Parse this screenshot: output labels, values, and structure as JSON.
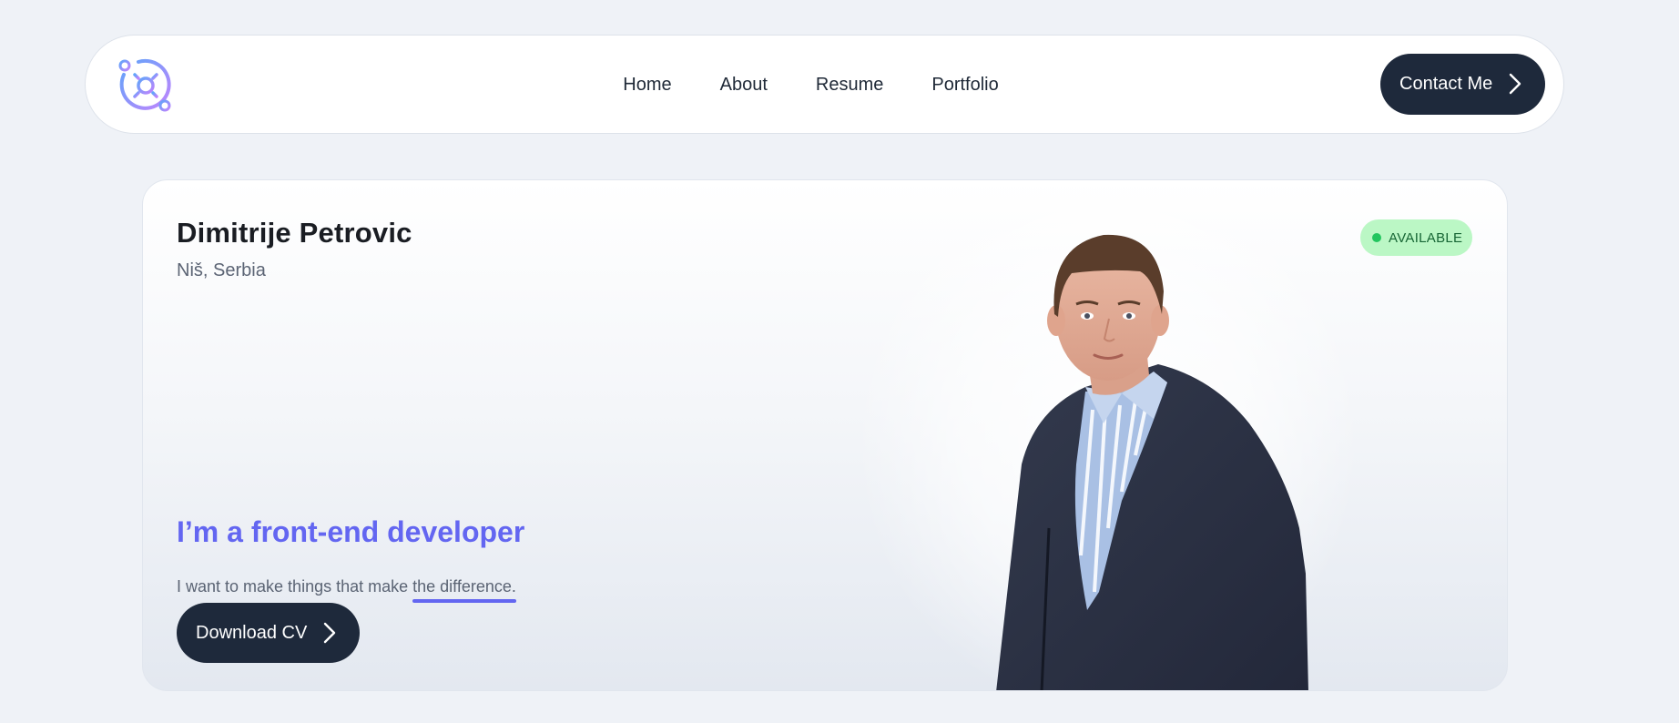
{
  "header": {
    "logo_icon": "gear-orbit-logo-icon",
    "nav": [
      {
        "label": "Home"
      },
      {
        "label": "About"
      },
      {
        "label": "Resume"
      },
      {
        "label": "Portfolio"
      }
    ],
    "contact_label": "Contact Me",
    "contact_icon": "chevron-right-icon"
  },
  "hero": {
    "name": "Dimitrije Petrovic",
    "location": "Niš, Serbia",
    "status_badge": "AVAILABLE",
    "status_color": "#22c55e",
    "headline": "I’m a front-end developer",
    "tagline_prefix": "I want to make things that make ",
    "tagline_highlight": "the difference.",
    "download_label": "Download CV",
    "download_icon": "chevron-right-icon",
    "portrait": "person-portrait"
  },
  "colors": {
    "accent": "#6366f1",
    "button_dark": "#1e293b",
    "badge_bg": "#bbf7c5",
    "page_bg": "#eff2f7"
  }
}
